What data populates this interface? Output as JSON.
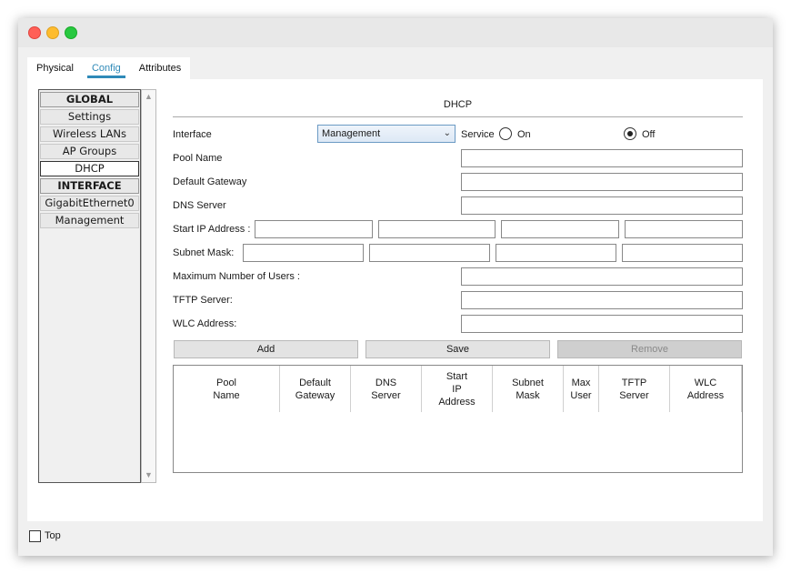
{
  "tabs": [
    "Physical",
    "Config",
    "Attributes"
  ],
  "nav": {
    "items": [
      {
        "label": "GLOBAL",
        "type": "header"
      },
      {
        "label": "Settings",
        "type": "item"
      },
      {
        "label": "Wireless LANs",
        "type": "item"
      },
      {
        "label": "AP Groups",
        "type": "item"
      },
      {
        "label": "DHCP",
        "type": "selected"
      },
      {
        "label": "INTERFACE",
        "type": "header"
      },
      {
        "label": "GigabitEthernet0",
        "type": "item"
      },
      {
        "label": "Management",
        "type": "item"
      }
    ]
  },
  "dhcp": {
    "title": "DHCP",
    "interface_label": "Interface",
    "interface_value": "Management",
    "service_label": "Service",
    "on_label": "On",
    "off_label": "Off",
    "service_selected": "Off",
    "pool_name_label": "Pool Name",
    "pool_name_value": "",
    "default_gateway_label": "Default Gateway",
    "default_gateway_value": "",
    "dns_server_label": "DNS Server",
    "dns_server_value": "",
    "start_ip_label": "Start IP Address :",
    "start_ip_octets": [
      "",
      "",
      "",
      ""
    ],
    "subnet_mask_label": "Subnet Mask:",
    "subnet_mask_octets": [
      "",
      "",
      "",
      ""
    ],
    "max_users_label": "Maximum Number of Users :",
    "max_users_value": "",
    "tftp_server_label": "TFTP Server:",
    "tftp_server_value": "",
    "wlc_address_label": "WLC Address:",
    "wlc_address_value": "",
    "add_label": "Add",
    "save_label": "Save",
    "remove_label": "Remove",
    "table_headers": [
      "Pool\nName",
      "Default\nGateway",
      "DNS\nServer",
      "Start\nIP\nAddress",
      "Subnet\nMask",
      "Max\nUser",
      "TFTP\nServer",
      "WLC\nAddress"
    ]
  },
  "footer": {
    "top_label": "Top"
  },
  "colors": {
    "accent": "#2f8ab8",
    "close": "#ff5f57",
    "minimize": "#febc2e",
    "maximize": "#28c840"
  }
}
